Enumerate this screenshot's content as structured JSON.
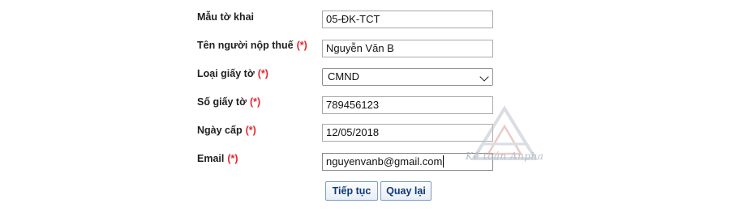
{
  "form": {
    "rows": [
      {
        "label": "Mẫu tờ khai",
        "required": "",
        "value": "05-ĐK-TCT",
        "type": "text"
      },
      {
        "label": "Tên người nộp thuế",
        "required": "(*)",
        "value": "Nguyễn Văn B",
        "type": "text"
      },
      {
        "label": "Loại giấy tờ",
        "required": "(*)",
        "value": "CMND",
        "type": "select"
      },
      {
        "label": "Số giấy tờ",
        "required": "(*)",
        "value": "789456123",
        "type": "text"
      },
      {
        "label": "Ngày cấp",
        "required": "(*)",
        "value": "12/05/2018",
        "type": "text"
      },
      {
        "label": "Email",
        "required": "(*)",
        "value": "nguyenvanb@gmail.com",
        "type": "text"
      }
    ],
    "buttons": {
      "continue": "Tiếp tục",
      "back": "Quay lại"
    }
  },
  "watermark": {
    "text": "Kế toán Anpha",
    "icon": "triangle-logo-icon"
  },
  "colors": {
    "required": "#e3262d",
    "button_text": "#0d3a74",
    "button_border": "#7a9cc6"
  }
}
